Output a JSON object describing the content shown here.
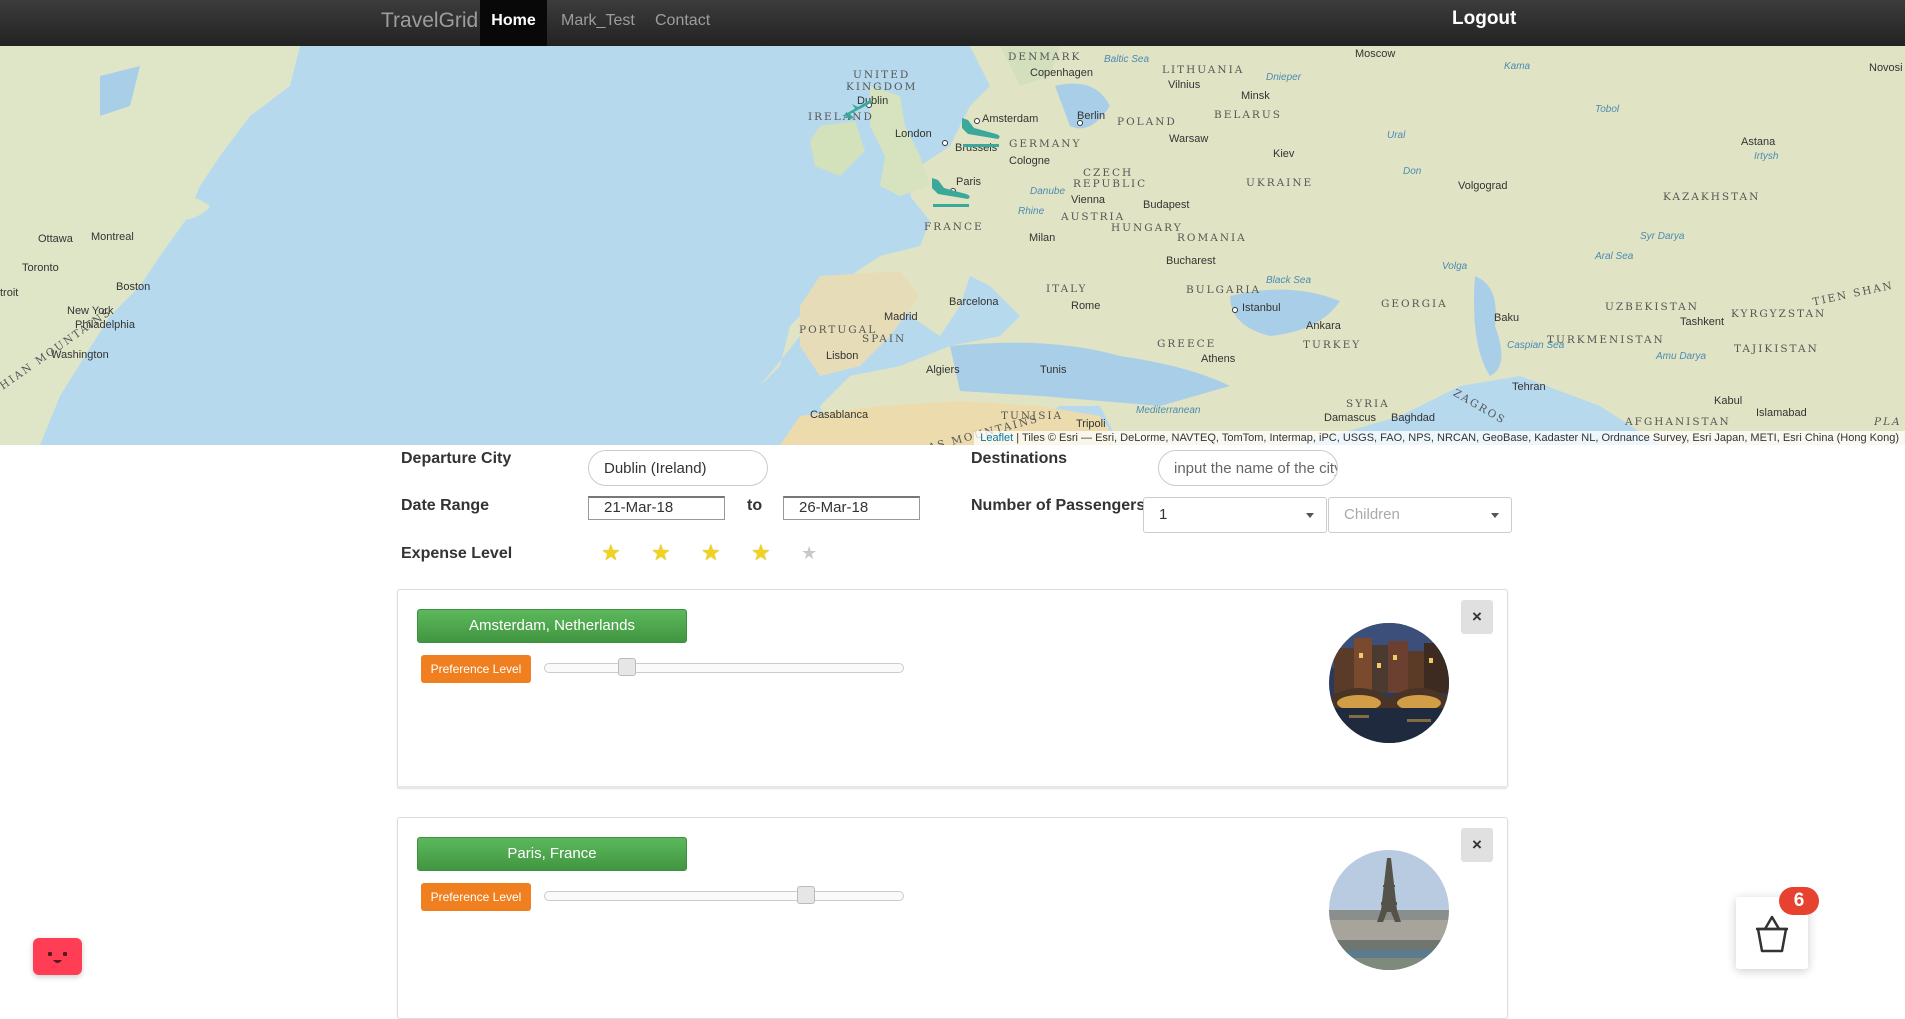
{
  "navbar": {
    "brand": "TravelGrid",
    "items": [
      {
        "label": "Home",
        "active": true
      },
      {
        "label": "Mark_Test",
        "active": false
      },
      {
        "label": "Contact",
        "active": false
      }
    ],
    "logout": "Logout"
  },
  "map": {
    "countries": [
      "DENMARK",
      "LITHUANIA",
      "BELARUS",
      "POLAND",
      "UNITED",
      "KINGDOM",
      "IRELAND",
      "GERMANY",
      "CZECH",
      "REPUBLIC",
      "UKRAINE",
      "AUSTRIA",
      "HUNGARY",
      "ROMANIA",
      "FRANCE",
      "ITALY",
      "BULGARIA",
      "PORTUGAL",
      "SPAIN",
      "GREECE",
      "TURKEY",
      "GEORGIA",
      "UZBEKISTAN",
      "TURKMENISTAN",
      "KYRGYZSTAN",
      "TAJIKISTAN",
      "KAZAKHSTAN",
      "AFGHANISTAN",
      "TUNISIA",
      "SYRIA",
      "ATLAS MOUNTAINS",
      "CHIAN MOUNTAINS",
      "ZAGROS",
      "TIEN SHAN",
      "PLA"
    ],
    "cities": [
      "Moscow",
      "Novosi",
      "Copenhagen",
      "Vilnius",
      "Minsk",
      "Dublin",
      "Amsterdam",
      "Berlin",
      "Warsaw",
      "London",
      "Brussels",
      "Cologne",
      "Kiev",
      "Astana",
      "Paris",
      "Vienna",
      "Budapest",
      "Volgograd",
      "Milan",
      "Bucharest",
      "Ottawa",
      "Montreal",
      "Toronto",
      "Boston",
      "New York",
      "Philadelphia",
      "Washington",
      "Barcelona",
      "Madrid",
      "Rome",
      "Istanbul",
      "Ankara",
      "Baku",
      "Tashkent",
      "Lisbon",
      "Algiers",
      "Tunis",
      "Athens",
      "Tehran",
      "Casablanca",
      "Tripoli",
      "Damascus",
      "Baghdad",
      "Kabul",
      "Islamabad",
      "troit"
    ],
    "waters": [
      "Baltic Sea",
      "Black Sea",
      "Caspian Sea",
      "Aral Sea",
      "Mediterranean",
      "Ural",
      "Danube",
      "Dnieper",
      "Kama",
      "Tobol",
      "Don",
      "Volga",
      "Irtysh",
      "Rhine",
      "Syr Darya",
      "Amu Darya"
    ],
    "attribution_link": "Leaflet",
    "attribution_text": " | Tiles © Esri — Esri, DeLorme, NAVTEQ, TomTom, Intermap, iPC, USGS, FAO, NPS, NRCAN, GeoBase, Kadaster NL, Ordnance Survey, Esri Japan, METI, Esri China (Hong Kong)"
  },
  "form": {
    "departure_label": "Departure City",
    "departure_value": "Dublin (Ireland)",
    "date_label": "Date Range",
    "date_from": "21-Mar-18",
    "date_to_label": "to",
    "date_to": "26-Mar-18",
    "expense_label": "Expense Level",
    "expense_level": 4,
    "expense_max": 5,
    "destinations_label": "Destinations",
    "destinations_placeholder": "input the name of the city",
    "passengers_label": "Number of Passengers",
    "adults_value": "1",
    "children_placeholder": "Children"
  },
  "destinations": [
    {
      "name": "Amsterdam, Netherlands",
      "preference_label": "Preference Level",
      "preference": 0.23,
      "close": "×"
    },
    {
      "name": "Paris, France",
      "preference_label": "Preference Level",
      "preference": 0.73,
      "close": "×"
    }
  ],
  "cart": {
    "count": "6"
  }
}
